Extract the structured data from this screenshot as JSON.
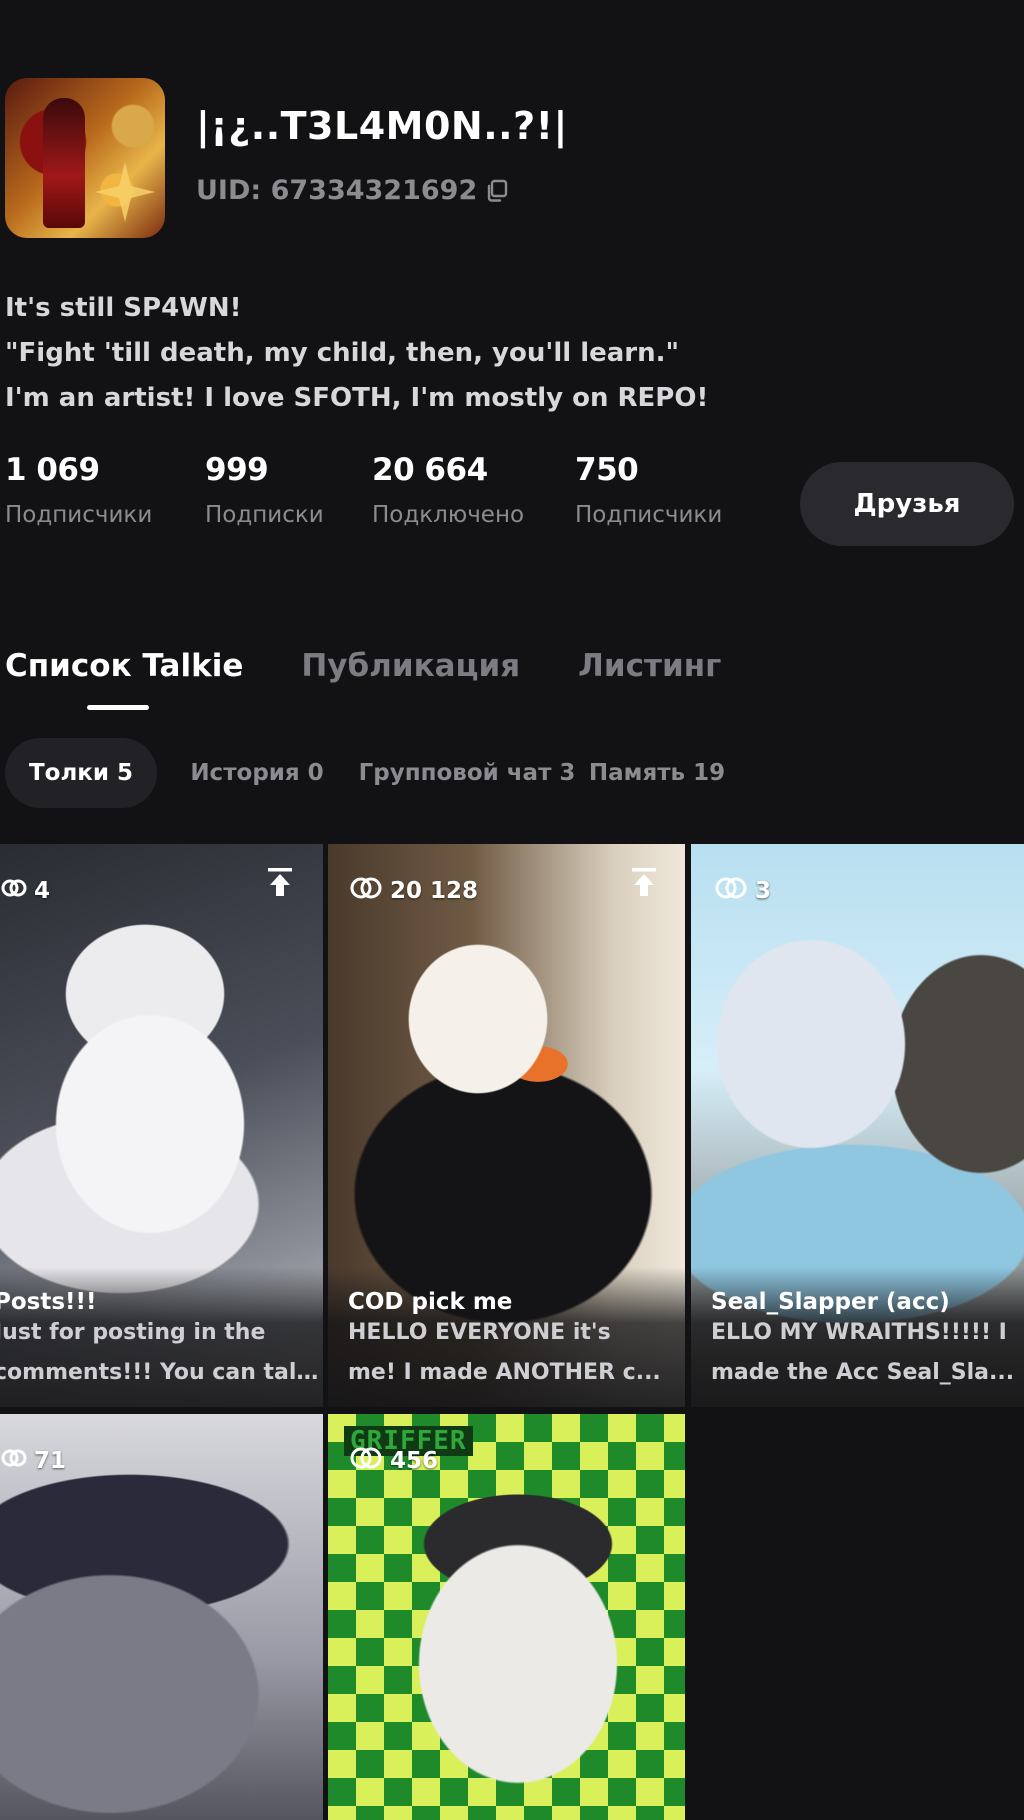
{
  "profile": {
    "username": "|¡¿..T3L4M0N..?!|",
    "uid": "UID: 67334321692",
    "bio": [
      "It's still SP4WN!",
      "\"Fight 'till death, my child, then, you'll learn.\"",
      "I'm an artist! I love SFOTH, I'm mostly on REPO!"
    ]
  },
  "stats": [
    {
      "value": "1 069",
      "label": "Подписчики"
    },
    {
      "value": "999",
      "label": "Подписки"
    },
    {
      "value": "20 664",
      "label": "Подключено"
    },
    {
      "value": "750",
      "label": "Подписчики"
    }
  ],
  "friends_button": "Друзья",
  "tabs": [
    {
      "label": "Список Talkie",
      "active": true
    },
    {
      "label": "Публикация",
      "active": false
    },
    {
      "label": "Листинг",
      "active": false
    }
  ],
  "filters": [
    {
      "label": "Толки 5",
      "active": true
    },
    {
      "label": "История 0",
      "active": false
    },
    {
      "label": "Групповой чат 3",
      "active": false
    },
    {
      "label": "Память 19",
      "active": false
    }
  ],
  "cards": [
    {
      "count": "4",
      "pinned": true,
      "title": "Posts!!!",
      "desc": [
        "Just for posting in the",
        "comments!!! You can tal..."
      ]
    },
    {
      "count": "20 128",
      "pinned": true,
      "title": "COD pick me",
      "desc": [
        "HELLO EVERYONE it's",
        "me! I made ANOTHER c..."
      ]
    },
    {
      "count": "3",
      "pinned": false,
      "title": "Seal_Slapper (acc)",
      "desc": [
        "ELLO MY WRAITHS!!!!! I",
        "made the Acc Seal_Sla..."
      ]
    },
    {
      "count": "71",
      "pinned": false,
      "title": "",
      "desc": []
    },
    {
      "count": "456",
      "pinned": false,
      "title": "",
      "desc": [],
      "art_text": "GRIFFER"
    }
  ],
  "colors": {
    "background": "#121214",
    "muted_text": "#8b8b90",
    "button_bg": "#2a2a2e",
    "chip_active_bg": "#222226"
  },
  "icons": {
    "copy": "copy-icon",
    "link": "link-icon",
    "pin": "pin-to-top-icon"
  }
}
